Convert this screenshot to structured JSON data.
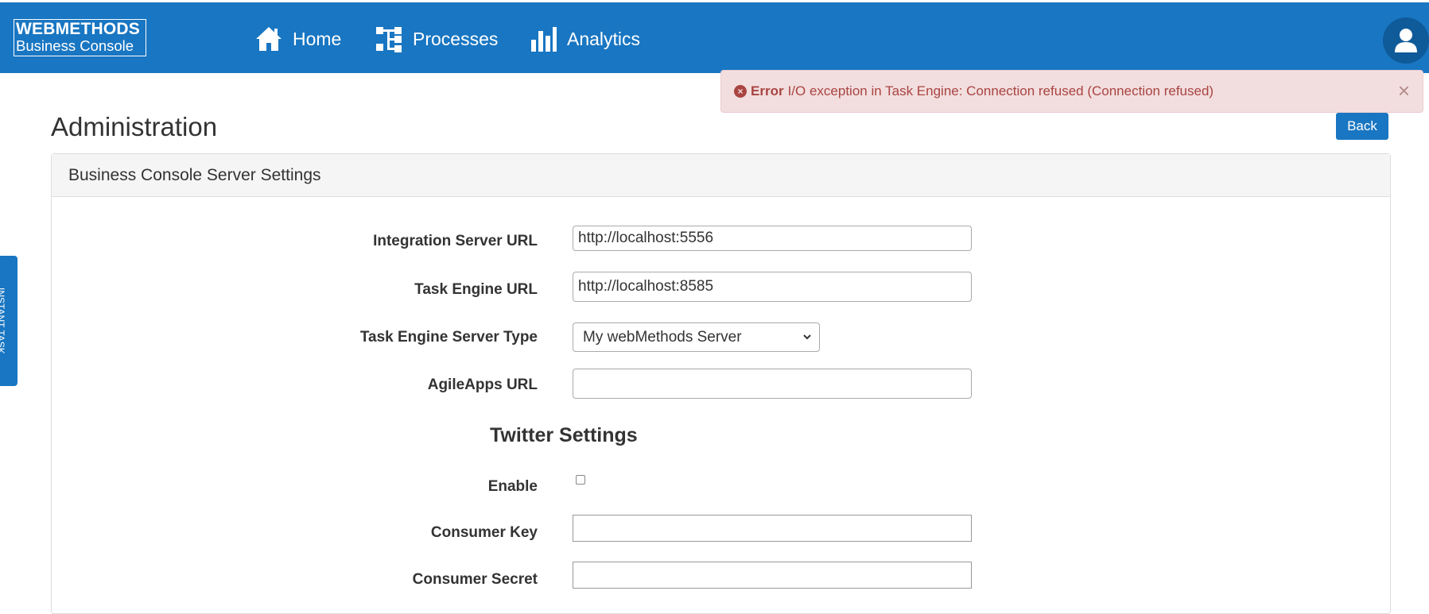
{
  "header": {
    "logo_line1": "WEBMETHODS",
    "logo_line2": "Business Console",
    "nav": {
      "home": "Home",
      "processes": "Processes",
      "analytics": "Analytics"
    },
    "brand_color": "#1976c2"
  },
  "alert": {
    "label": "Error",
    "message": "I/O exception in Task Engine: Connection refused (Connection refused)",
    "close": "×"
  },
  "page": {
    "title": "Administration",
    "back_label": "Back"
  },
  "side_tab": {
    "label": "INSTANT TASK"
  },
  "panel": {
    "title": "Business Console Server Settings",
    "fields": {
      "integration_server_url": {
        "label": "Integration Server URL",
        "value": "http://localhost:5556"
      },
      "task_engine_url": {
        "label": "Task Engine URL",
        "value": "http://localhost:8585"
      },
      "task_engine_server_type": {
        "label": "Task Engine Server Type",
        "value": "My webMethods Server"
      },
      "agileapps_url": {
        "label": "AgileApps URL",
        "value": ""
      }
    },
    "twitter": {
      "title": "Twitter Settings",
      "enable_label": "Enable",
      "enable_checked": false,
      "consumer_key_label": "Consumer Key",
      "consumer_key_value": "",
      "consumer_secret_label": "Consumer Secret",
      "consumer_secret_value": ""
    }
  }
}
